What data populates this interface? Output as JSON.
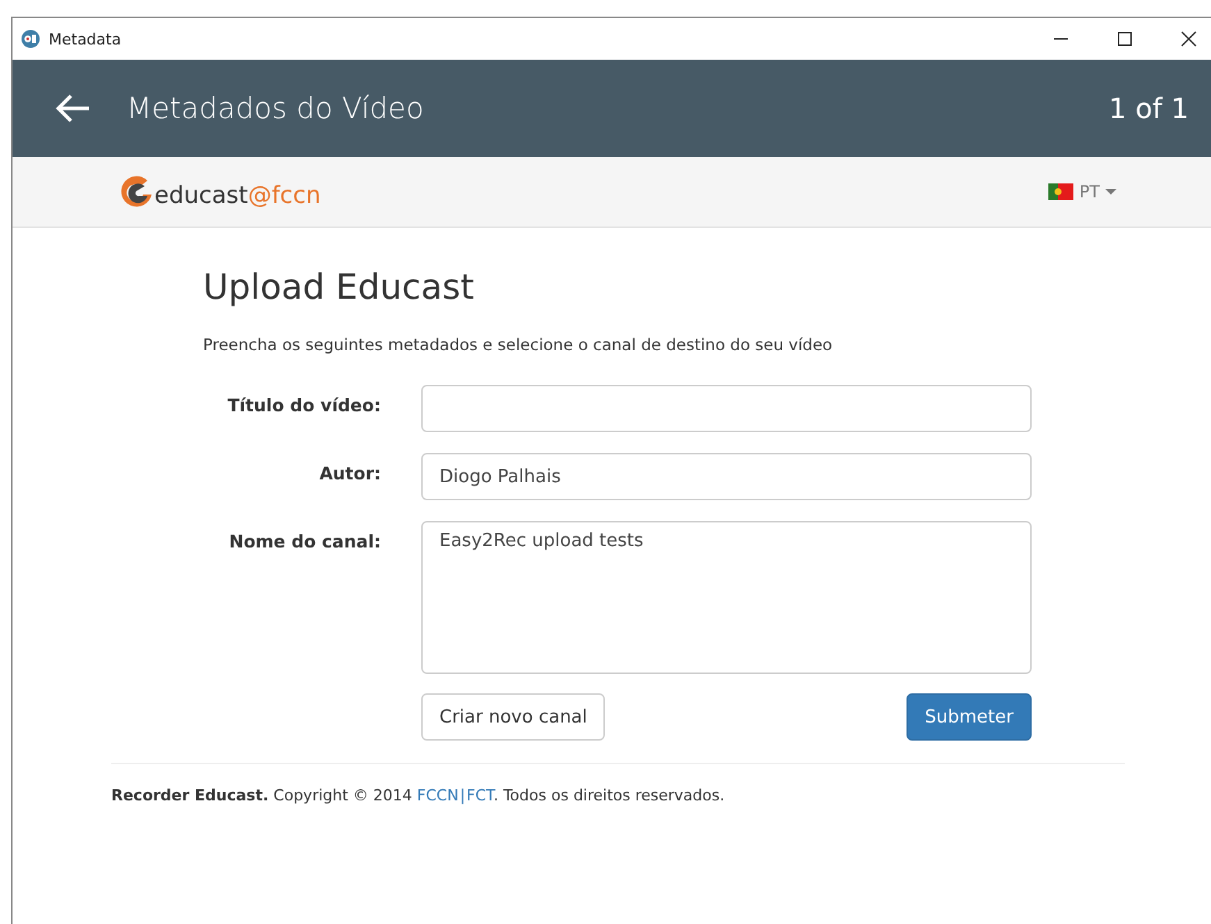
{
  "window": {
    "title": "Metadata"
  },
  "header": {
    "title": "Metadados do Vídeo",
    "counter": "1 of 1"
  },
  "brand": {
    "logo_text": "educast",
    "logo_suffix": "@fccn",
    "language": "PT"
  },
  "page": {
    "heading": "Upload Educast",
    "intro": "Preencha os seguintes metadados e selecione o canal de destino do seu vídeo"
  },
  "fields": [
    {
      "kind": "input",
      "label": "Título do vídeo:"
    },
    {
      "kind": "input",
      "label": "Autor:",
      "value": "Diogo Palhais"
    },
    {
      "kind": "textarea",
      "label": "Nome do canal:",
      "value": "Easy2Rec upload tests"
    }
  ],
  "buttons": [
    {
      "kind": "secondary",
      "label": "Criar novo canal"
    },
    {
      "kind": "primary",
      "label": "Submeter"
    }
  ],
  "footer": {
    "brand": "Recorder Educast.",
    "text": "Copyright © 2014",
    "links": [
      "FCCN",
      "FCT"
    ],
    "separator": "|",
    "suffix": ". Todos os direitos reservados."
  }
}
